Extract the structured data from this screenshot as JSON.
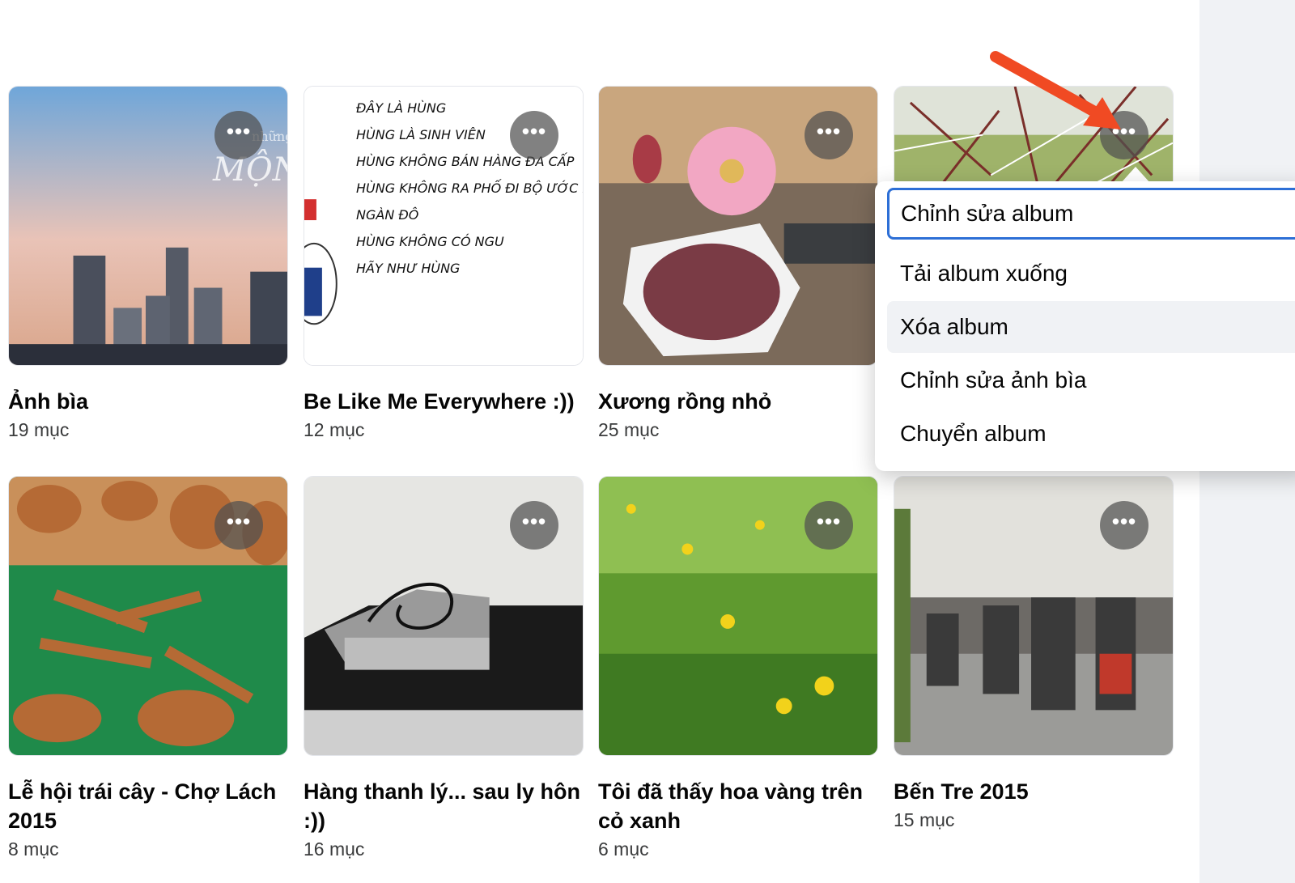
{
  "albums": [
    {
      "title": "Ảnh bìa",
      "count": "19 mục"
    },
    {
      "title": "Be Like Me Everywhere :))",
      "count": "12 mục"
    },
    {
      "title": "Xương rồng nhỏ",
      "count": "25 mục"
    },
    {
      "title": "",
      "count": ""
    },
    {
      "title": "Lễ hội trái cây - Chợ Lách 2015",
      "count": "8 mục"
    },
    {
      "title": "Hàng thanh lý... sau ly hôn :))",
      "count": "16 mục"
    },
    {
      "title": "Tôi đã thấy hoa vàng trên cỏ xanh",
      "count": "6 mục"
    },
    {
      "title": "Bến Tre 2015",
      "count": "15 mục"
    }
  ],
  "more_button_glyph": "•••",
  "cover_text": {
    "album1_overlay": "những",
    "album1_overlay2": "MỘNG",
    "album2_lines": [
      "ĐÂY LÀ HÙNG",
      "HÙNG LÀ SINH VIÊN",
      "HÙNG KHÔNG BÁN HÀNG ĐA CẤP",
      "HÙNG KHÔNG RA PHỐ ĐI BỘ ƯỚC LỰ",
      "NGÀN ĐÔ",
      "HÙNG KHÔNG CÓ NGU",
      "HÃY NHƯ HÙNG"
    ]
  },
  "context_menu": {
    "items": [
      {
        "label": "Chỉnh sửa album"
      },
      {
        "label": "Tải album xuống"
      },
      {
        "label": "Xóa album"
      },
      {
        "label": "Chỉnh sửa ảnh bìa"
      },
      {
        "label": "Chuyển album"
      }
    ]
  },
  "colors": {
    "annotation_arrow": "#f04a23",
    "focus_ring": "#2d6fd6"
  }
}
